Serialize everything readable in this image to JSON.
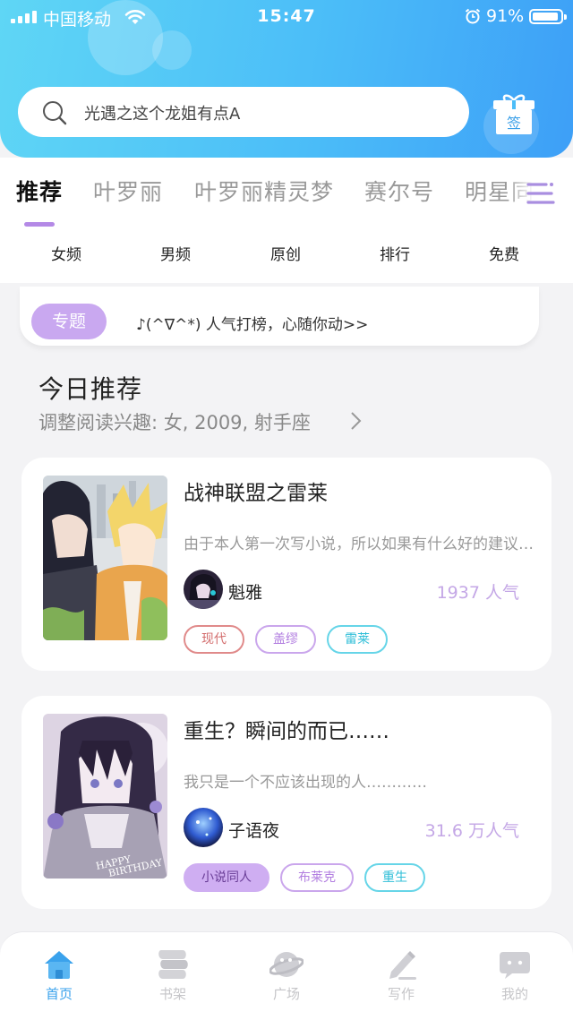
{
  "status_bar": {
    "carrier": "中国移动",
    "time": "15:47",
    "battery": "91%"
  },
  "search": {
    "placeholder": "光遇之这个龙姐有点A"
  },
  "gift": {
    "label": "签"
  },
  "tabs": [
    {
      "label": "推荐",
      "active": true
    },
    {
      "label": "叶罗丽",
      "active": false
    },
    {
      "label": "叶罗丽精灵梦",
      "active": false
    },
    {
      "label": "赛尔号",
      "active": false
    },
    {
      "label": "明星同",
      "active": false
    }
  ],
  "subcategories": [
    "女频",
    "男频",
    "原创",
    "排行",
    "免费"
  ],
  "topic": {
    "badge": "专题",
    "text": "♪(^∇^*) 人气打榜，心随你动>>"
  },
  "today": {
    "title": "今日推荐",
    "subtitle": "调整阅读兴趣: 女, 2009, 射手座"
  },
  "books": [
    {
      "title": "战神联盟之雷莱",
      "description": "由于本人第一次写小说，所以如果有什么好的建议请留言",
      "author": "魁雅",
      "popularity": "1937 人气",
      "tags": [
        {
          "label": "现代",
          "style": "red"
        },
        {
          "label": "盖缪",
          "style": "purple"
        },
        {
          "label": "雷莱",
          "style": "cyan"
        }
      ]
    },
    {
      "title": "重生？瞬间的而已……",
      "description": "我只是一个不应该出现的人…………",
      "author": "子语夜",
      "popularity": "31.6 万人气",
      "tags": [
        {
          "label": "小说同人",
          "style": "filled"
        },
        {
          "label": "布莱克",
          "style": "purple"
        },
        {
          "label": "重生",
          "style": "cyan"
        }
      ]
    }
  ],
  "bottom_nav": [
    {
      "label": "首页",
      "icon": "home-icon",
      "active": true
    },
    {
      "label": "书架",
      "icon": "bookshelf-icon",
      "active": false
    },
    {
      "label": "广场",
      "icon": "planet-icon",
      "active": false
    },
    {
      "label": "写作",
      "icon": "pen-icon",
      "active": false
    },
    {
      "label": "我的",
      "icon": "chat-icon",
      "active": false
    }
  ],
  "colors": {
    "header_start": "#5fd6f5",
    "header_end": "#3d9ff7",
    "accent_purple": "#c9a8f0",
    "nav_active": "#3aa2ec"
  }
}
